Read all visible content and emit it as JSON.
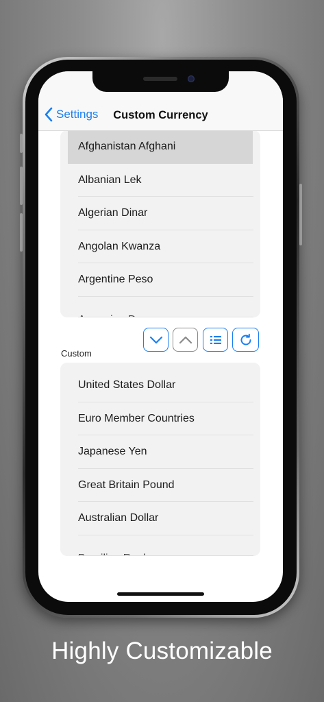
{
  "nav": {
    "back_label": "Settings",
    "title": "Custom Currency"
  },
  "currency_list": {
    "items": [
      "Afghanistan Afghani",
      "Albanian Lek",
      "Algerian Dinar",
      "Angolan Kwanza",
      "Argentine Peso",
      "Armenian Dram"
    ],
    "selected_index": 0
  },
  "controls": [
    {
      "name": "move-down-button",
      "icon": "chevron-down-icon",
      "color": "#1a7ff0"
    },
    {
      "name": "move-up-button",
      "icon": "chevron-up-icon",
      "color": "#8a8a8a"
    },
    {
      "name": "list-button",
      "icon": "list-icon",
      "color": "#1a7ff0"
    },
    {
      "name": "reset-button",
      "icon": "refresh-icon",
      "color": "#1a7ff0"
    }
  ],
  "custom_section": {
    "label": "Custom",
    "items": [
      "United States Dollar",
      "Euro Member Countries",
      "Japanese Yen",
      "Great Britain Pound",
      "Australian Dollar",
      "Brazilian Real"
    ]
  },
  "caption": "Highly Customizable",
  "colors": {
    "accent": "#1a7ff0",
    "background_top": "#a8a8a8",
    "background_bottom": "#6a6a6a"
  }
}
